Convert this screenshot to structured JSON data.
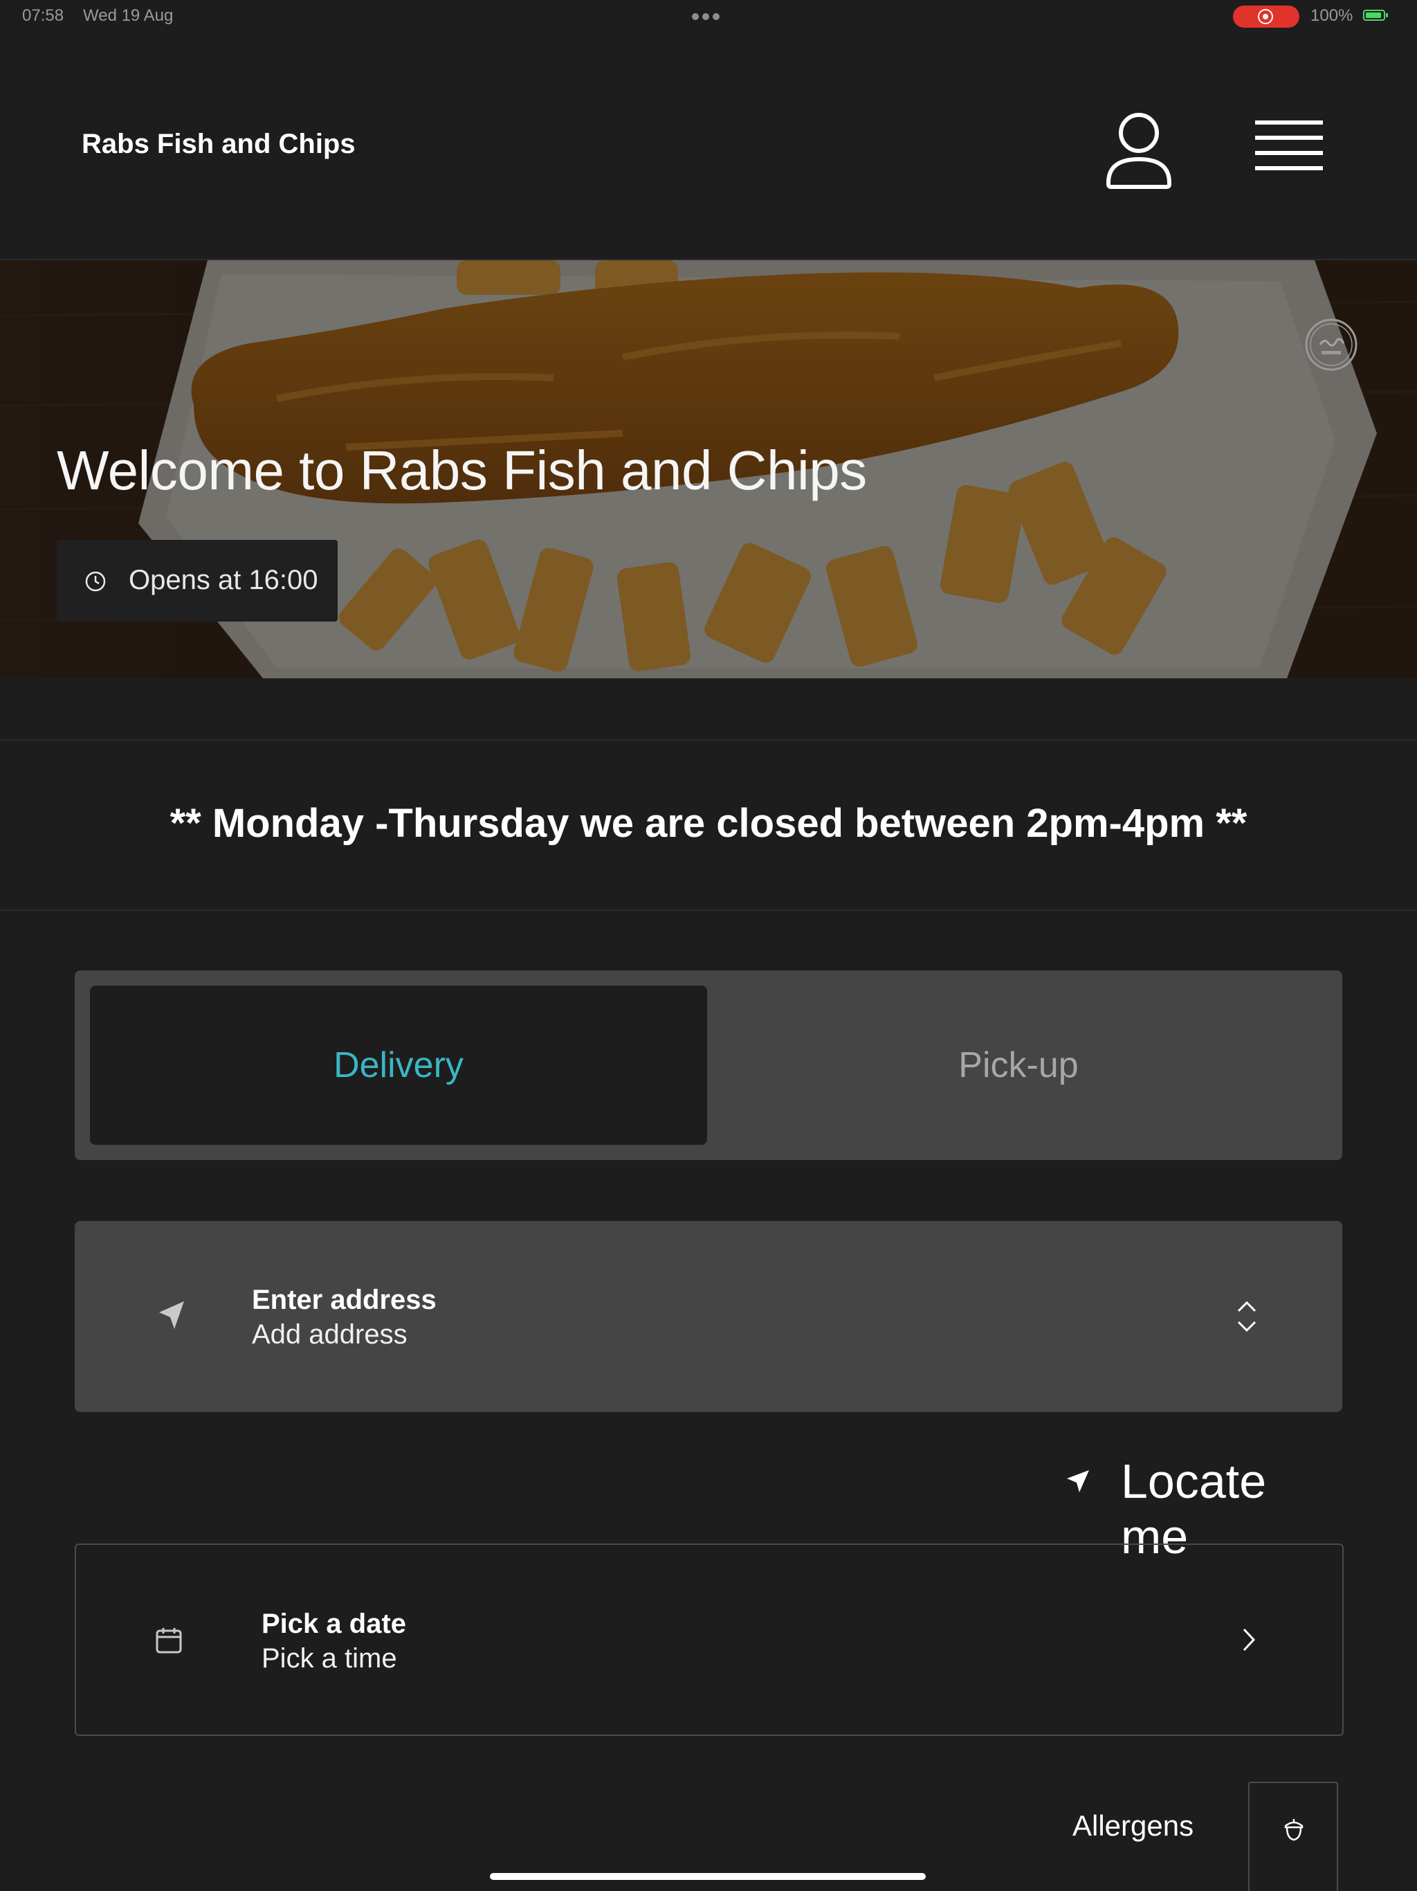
{
  "status_bar": {
    "time": "07:58",
    "date": "Wed 19 Aug",
    "battery": "100%",
    "recording_color": "#e0332b"
  },
  "header": {
    "brand": "Rabs Fish and Chips",
    "profile_icon": "user-icon",
    "menu_icon": "hamburger-menu-icon"
  },
  "hero": {
    "title": "Welcome to Rabs Fish and Chips",
    "opening": "Opens at 16:00",
    "badge_icon": "halal-badge-icon"
  },
  "notice": {
    "text": "** Monday -Thursday we are closed between 2pm-4pm **"
  },
  "order_mode": {
    "tabs": [
      {
        "label": "Delivery",
        "selected": true
      },
      {
        "label": "Pick-up",
        "selected": false
      }
    ],
    "accent_color": "#3bb6c4"
  },
  "address": {
    "label": "Enter address",
    "value": "Add address"
  },
  "locate": {
    "label": "Locate me"
  },
  "schedule": {
    "date_label": "Pick a date",
    "time_label": "Pick a time"
  },
  "allergens": {
    "label": "Allergens"
  }
}
